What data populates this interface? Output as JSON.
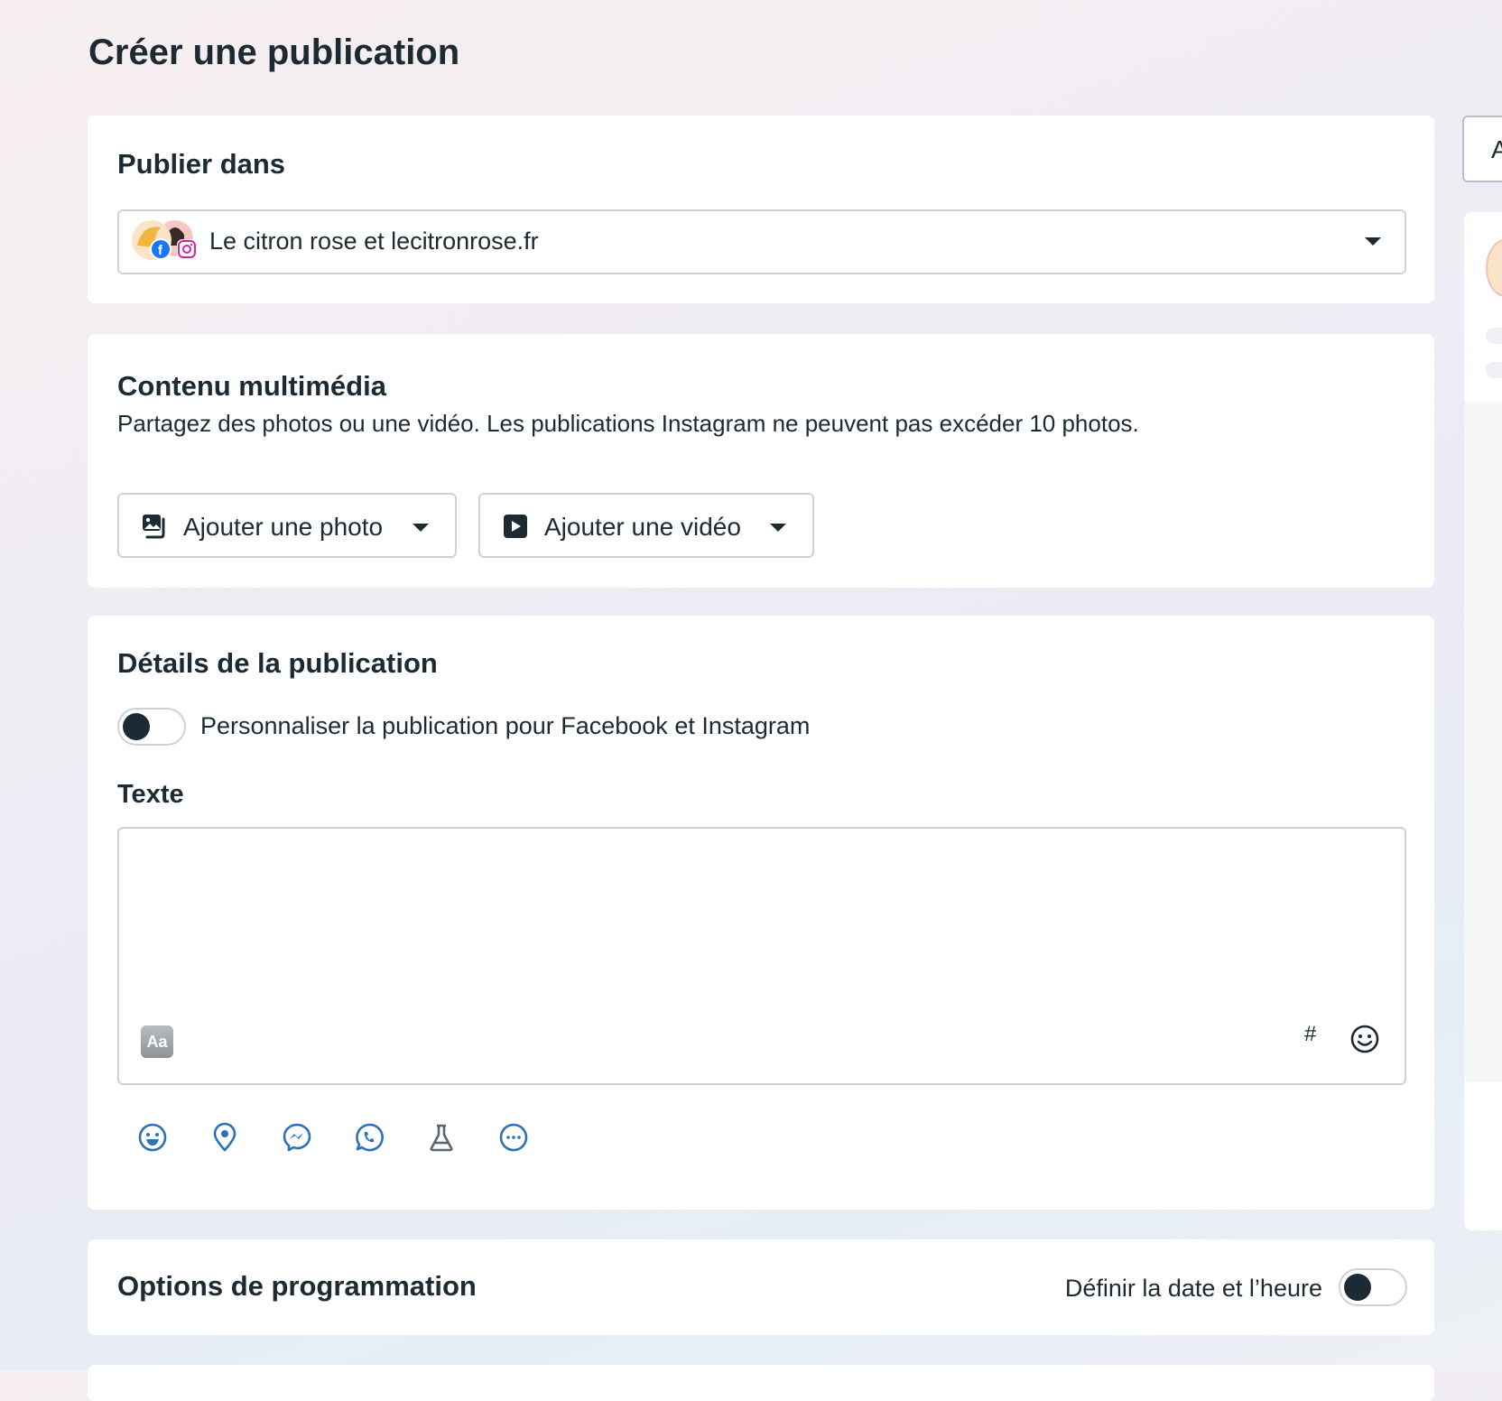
{
  "page": {
    "title": "Créer une publication"
  },
  "publish_in": {
    "title": "Publier dans",
    "account_label": "Le citron rose et lecitronrose.fr"
  },
  "media": {
    "title": "Contenu multimédia",
    "subtitle": "Partagez des photos ou une vidéo. Les publications Instagram ne peuvent pas excéder 10 photos.",
    "add_photo_label": "Ajouter une photo",
    "add_video_label": "Ajouter une vidéo"
  },
  "details": {
    "title": "Détails de la publication",
    "customize_toggle_label": "Personnaliser la publication pour Facebook et Instagram",
    "customize_toggle_on": false,
    "text_label": "Texte",
    "text_value": "",
    "text_format_icon_label": "Aa",
    "hashtag_icon_label": "#"
  },
  "toolbar_icons": [
    "feeling-icon",
    "location-icon",
    "messenger-icon",
    "whatsapp-icon",
    "experiment-icon",
    "more-icon"
  ],
  "scheduling": {
    "title": "Options de programmation",
    "toggle_label": "Définir la date et l’heure",
    "toggle_on": false
  },
  "right_panel": {
    "top_button_label": "A"
  },
  "colors": {
    "accent_blue": "#1b74e4",
    "icon_blue": "#2d72b8",
    "text_dark": "#1c2b33",
    "border": "#cbd2d9"
  }
}
